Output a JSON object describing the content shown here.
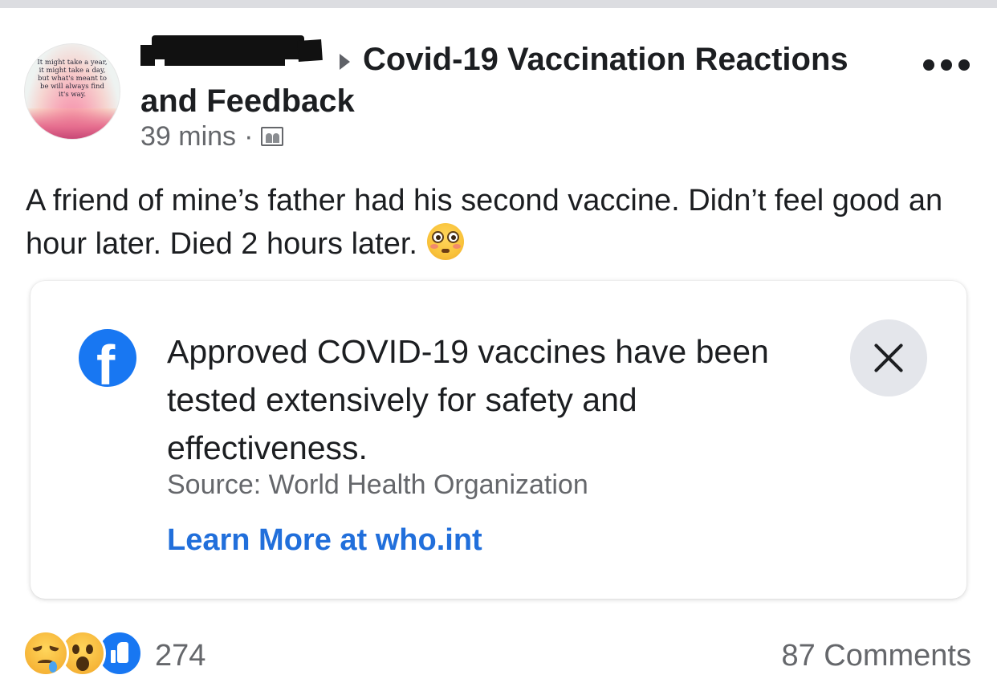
{
  "post": {
    "avatar_text": "It might take a year, it might take a day, but what's meant to be will always find it's way.",
    "author_name_redacted": true,
    "group_name": "Covid-19 Vaccination Reactions and Feedback",
    "timestamp": "39 mins",
    "separator": "·",
    "privacy_icon": "group-members-icon",
    "text": "A friend of mine’s father had his second vaccine. Didn’t feel good an hour later. Died 2 hours later.",
    "text_emoji": "flushed-face-emoji"
  },
  "info_card": {
    "logo_letter": "f",
    "message": "Approved COVID-19 vaccines have been tested extensively for safety and effectiveness.",
    "source": "Source: World Health Organization",
    "link_label": "Learn More at who.int",
    "brand_color": "#1877f2",
    "link_color": "#216fdb"
  },
  "footer": {
    "reactions": [
      "sad-reaction-icon",
      "wow-reaction-icon",
      "like-reaction-icon"
    ],
    "reaction_count": "274",
    "comments": "87 Comments"
  }
}
